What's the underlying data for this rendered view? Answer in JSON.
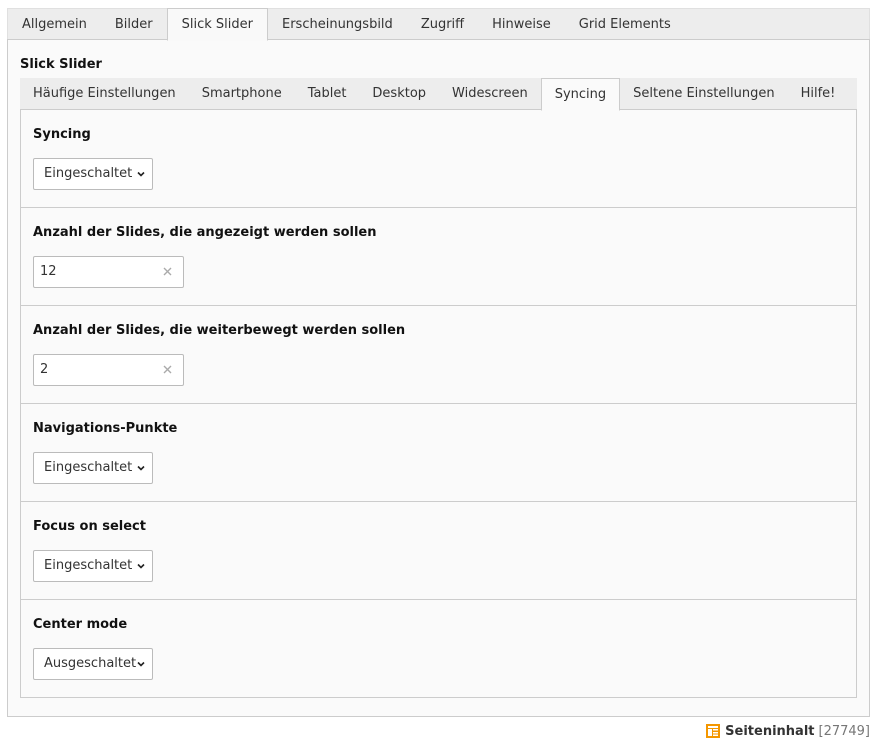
{
  "outer_tabs": [
    {
      "label": "Allgemein",
      "active": false
    },
    {
      "label": "Bilder",
      "active": false
    },
    {
      "label": "Slick Slider",
      "active": true
    },
    {
      "label": "Erscheinungsbild",
      "active": false
    },
    {
      "label": "Zugriff",
      "active": false
    },
    {
      "label": "Hinweise",
      "active": false
    },
    {
      "label": "Grid Elements",
      "active": false
    }
  ],
  "section_title": "Slick Slider",
  "inner_tabs": [
    {
      "label": "Häufige Einstellungen",
      "active": false
    },
    {
      "label": "Smartphone",
      "active": false
    },
    {
      "label": "Tablet",
      "active": false
    },
    {
      "label": "Desktop",
      "active": false
    },
    {
      "label": "Widescreen",
      "active": false
    },
    {
      "label": "Syncing",
      "active": true
    },
    {
      "label": "Seltene Einstellungen",
      "active": false
    },
    {
      "label": "Hilfe!",
      "active": false
    }
  ],
  "fields": {
    "syncing": {
      "label": "Syncing",
      "value": "Eingeschaltet"
    },
    "slides_to_show": {
      "label": "Anzahl der Slides, die angezeigt werden sollen",
      "value": "12"
    },
    "slides_to_scroll": {
      "label": "Anzahl der Slides, die weiterbewegt werden sollen",
      "value": "2"
    },
    "dots": {
      "label": "Navigations-Punkte",
      "value": "Eingeschaltet"
    },
    "focus_on_select": {
      "label": "Focus on select",
      "value": "Eingeschaltet"
    },
    "center_mode": {
      "label": "Center mode",
      "value": "Ausgeschaltet"
    }
  },
  "footer": {
    "icon": "content-element-icon",
    "title": "Seiteninhalt",
    "id": "[27749]"
  },
  "colors": {
    "accent_orange": "#f49700",
    "border": "#cccccc",
    "tab_bar": "#ededed",
    "panel": "#fafafa"
  }
}
